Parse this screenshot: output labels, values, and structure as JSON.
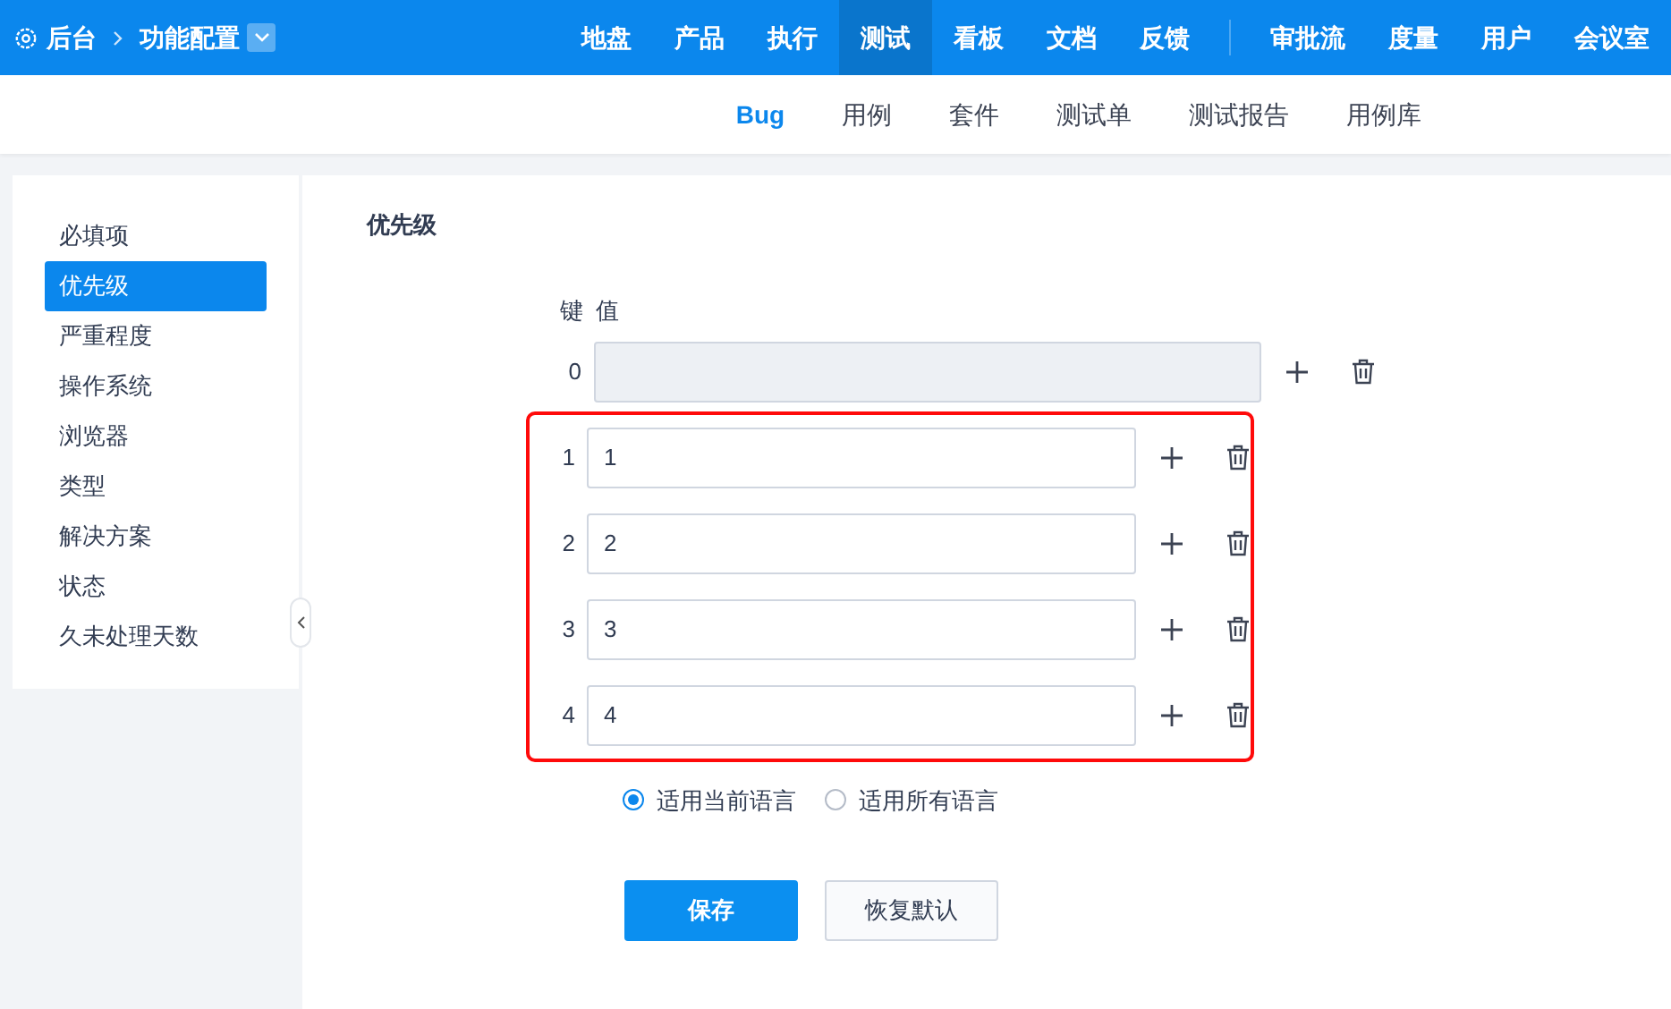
{
  "breadcrumb": {
    "root": "后台",
    "current": "功能配置"
  },
  "main_nav": [
    {
      "label": "地盘",
      "selected": false,
      "kind": "item"
    },
    {
      "label": "产品",
      "selected": false,
      "kind": "item"
    },
    {
      "label": "执行",
      "selected": false,
      "kind": "item"
    },
    {
      "label": "测试",
      "selected": true,
      "kind": "item"
    },
    {
      "label": "看板",
      "selected": false,
      "kind": "item"
    },
    {
      "label": "文档",
      "selected": false,
      "kind": "item"
    },
    {
      "label": "反馈",
      "selected": false,
      "kind": "item"
    },
    {
      "kind": "divider"
    },
    {
      "label": "审批流",
      "selected": false,
      "kind": "item"
    },
    {
      "label": "度量",
      "selected": false,
      "kind": "item"
    },
    {
      "label": "用户",
      "selected": false,
      "kind": "item"
    },
    {
      "label": "会议室",
      "selected": false,
      "kind": "item"
    }
  ],
  "sub_nav": [
    {
      "label": "Bug",
      "selected": true
    },
    {
      "label": "用例",
      "selected": false
    },
    {
      "label": "套件",
      "selected": false
    },
    {
      "label": "测试单",
      "selected": false
    },
    {
      "label": "测试报告",
      "selected": false
    },
    {
      "label": "用例库",
      "selected": false
    }
  ],
  "sidebar": {
    "items": [
      {
        "label": "必填项",
        "selected": false
      },
      {
        "label": "优先级",
        "selected": true
      },
      {
        "label": "严重程度",
        "selected": false
      },
      {
        "label": "操作系统",
        "selected": false
      },
      {
        "label": "浏览器",
        "selected": false
      },
      {
        "label": "类型",
        "selected": false
      },
      {
        "label": "解决方案",
        "selected": false
      },
      {
        "label": "状态",
        "selected": false
      },
      {
        "label": "久未处理天数",
        "selected": false
      }
    ]
  },
  "form": {
    "title": "优先级",
    "key_header": "键",
    "value_header": "值",
    "rows": [
      {
        "key": "0",
        "value": "",
        "disabled": true,
        "highlighted": false
      },
      {
        "key": "1",
        "value": "1",
        "disabled": false,
        "highlighted": true
      },
      {
        "key": "2",
        "value": "2",
        "disabled": false,
        "highlighted": true
      },
      {
        "key": "3",
        "value": "3",
        "disabled": false,
        "highlighted": true
      },
      {
        "key": "4",
        "value": "4",
        "disabled": false,
        "highlighted": true
      }
    ],
    "scope_options": [
      {
        "label": "适用当前语言",
        "selected": true
      },
      {
        "label": "适用所有语言",
        "selected": false
      }
    ],
    "save_button": "保存",
    "reset_button": "恢复默认"
  }
}
